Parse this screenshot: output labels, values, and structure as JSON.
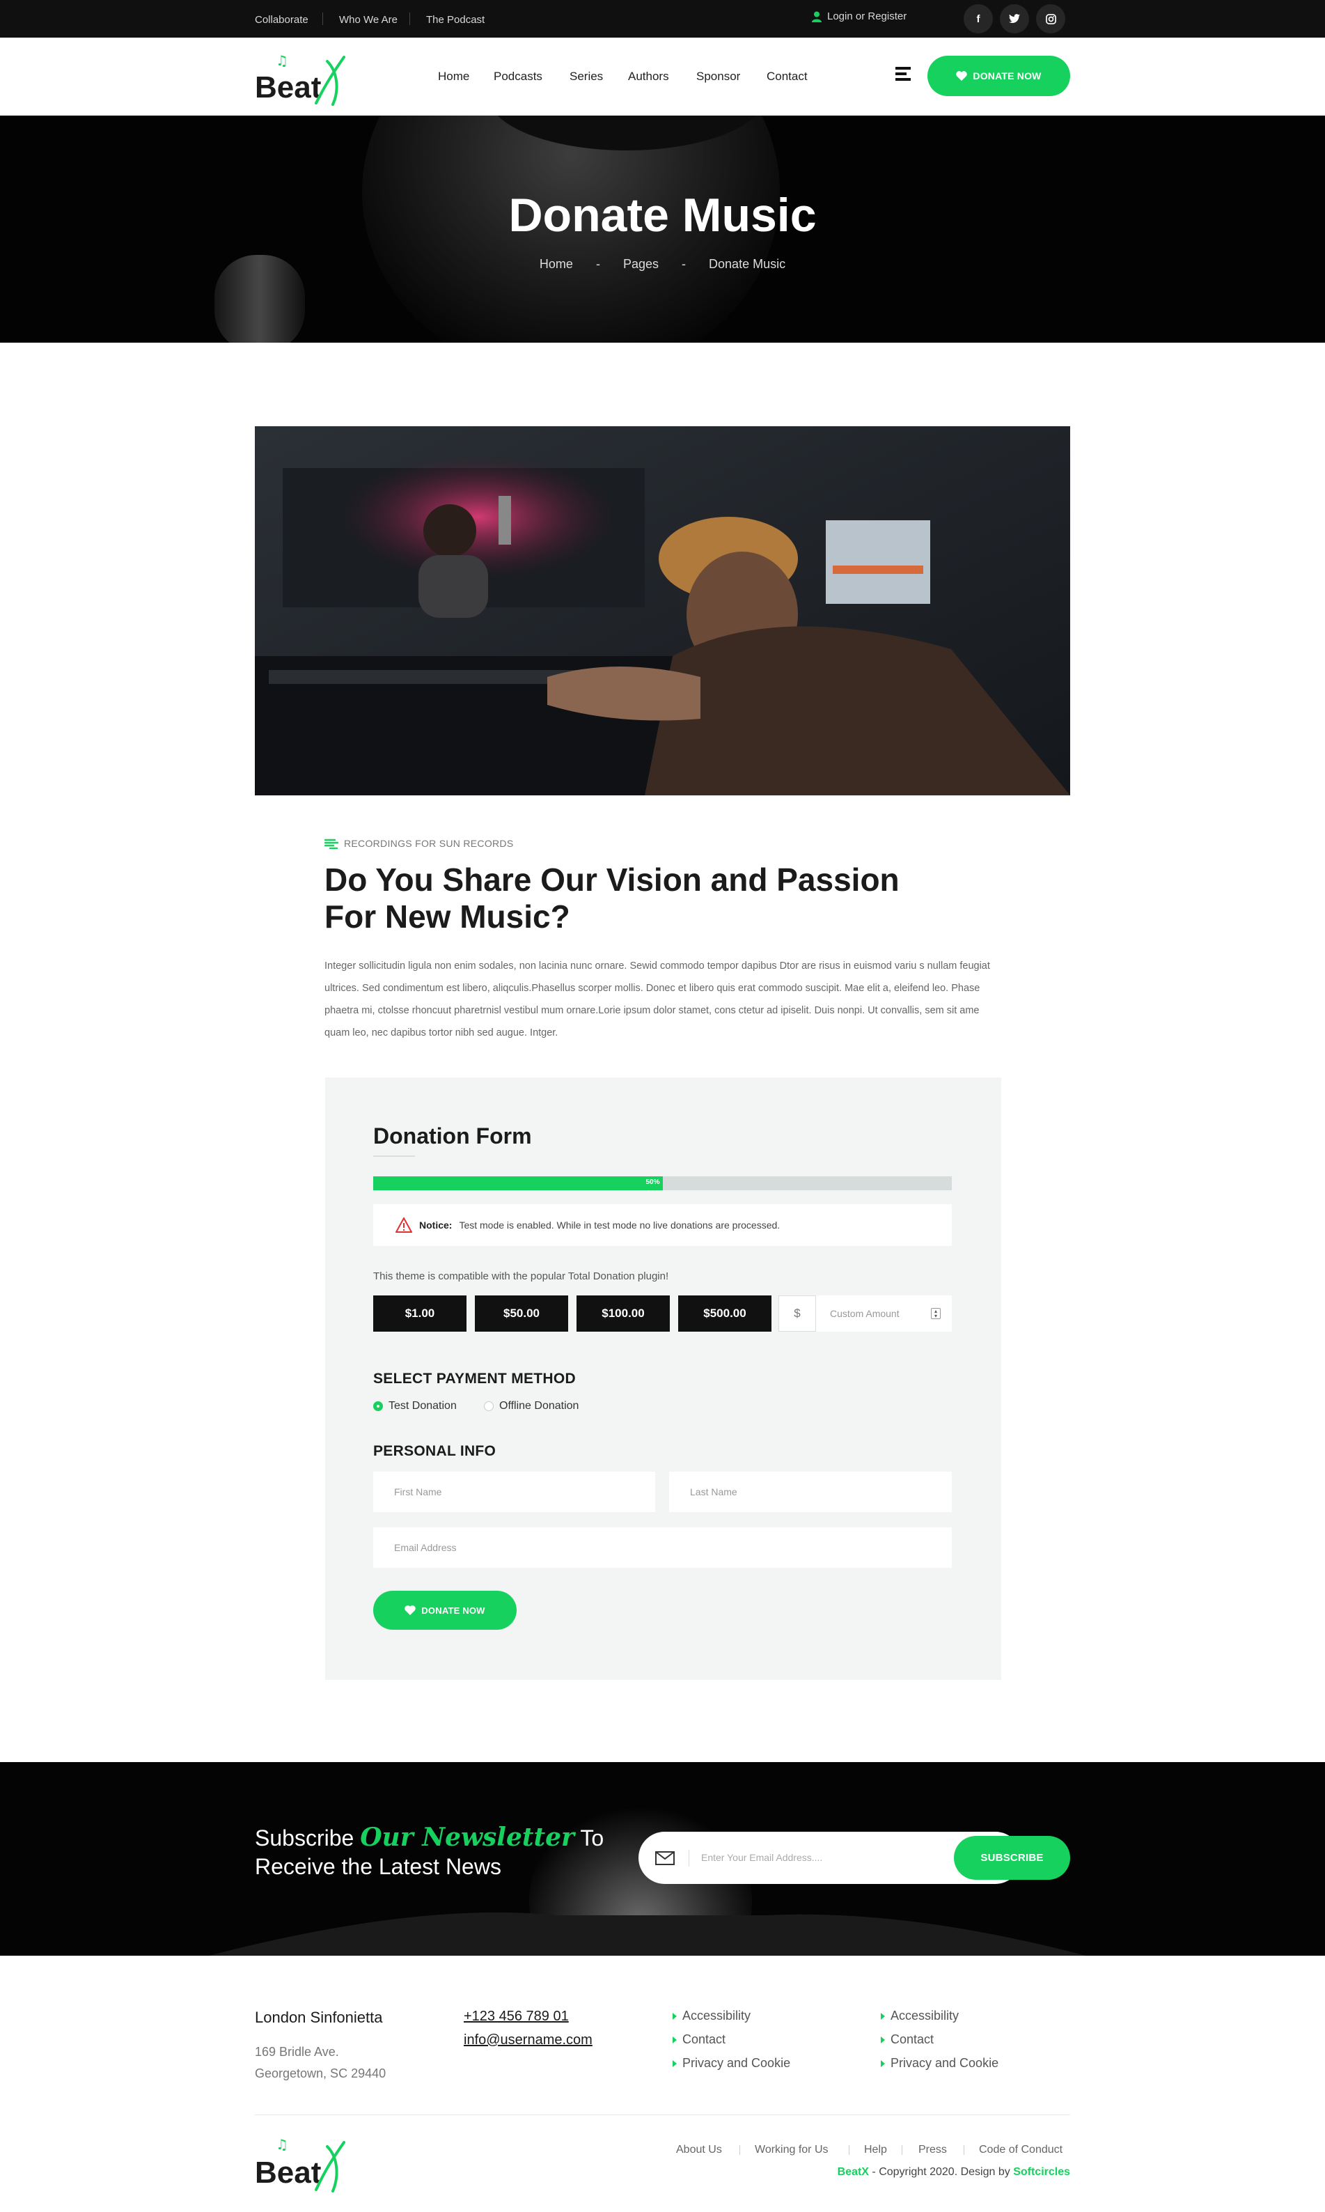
{
  "topbar": {
    "links": [
      "Collaborate",
      "Who We Are",
      "The Podcast"
    ],
    "login": "Login or Register",
    "social": [
      {
        "icon": "facebook-icon",
        "glyph": "f"
      },
      {
        "icon": "twitter-icon",
        "glyph": "t"
      },
      {
        "icon": "instagram-icon",
        "glyph": "◎"
      }
    ]
  },
  "header": {
    "logo_text": "Beat",
    "logo_accent": "X",
    "nav": [
      "Home",
      "Podcasts",
      "Series",
      "Authors",
      "Sponsor",
      "Contact"
    ],
    "donate_label": "DONATE NOW"
  },
  "hero": {
    "title": "Donate Music",
    "breadcrumb": [
      "Home",
      "-",
      "Pages",
      "-",
      "Donate Music"
    ]
  },
  "intro": {
    "eyebrow": "RECORDINGS FOR SUN RECORDS",
    "heading_line1": "Do You Share Our Vision and Passion",
    "heading_line2": "For New Music?",
    "paragraph": "Integer sollicitudin ligula non enim sodales, non lacinia nunc ornare. Sewid commodo tempor dapibus Dtor are risus in euismod variu s nullam feugiat ultrices. Sed condimentum est libero, aliqculis.Phasellus scorper mollis. Donec et libero quis erat commodo suscipit. Mae elit a, eleifend leo. Phase phaetra mi, ctolsse rhoncuut pharetrnisl vestibul mum ornare.Lorie ipsum dolor stamet, cons ctetur ad ipiselit. Duis nonpi. Ut convallis, sem sit ame quam leo, nec dapibus tortor nibh sed augue. Intger."
  },
  "donation_form": {
    "title": "Donation Form",
    "progress_percent": 50,
    "progress_label": "50%",
    "notice_label": "Notice:",
    "notice_text": "Test mode is enabled. While in test mode no live donations are processed.",
    "compat_text": "This theme is compatible with the popular Total Donation plugin!",
    "amounts": [
      "$1.00",
      "$50.00",
      "$100.00",
      "$500.00"
    ],
    "currency_symbol": "$",
    "custom_amount_placeholder": "Custom Amount",
    "payment_heading": "SELECT PAYMENT METHOD",
    "payment_options": [
      {
        "label": "Test Donation",
        "selected": true
      },
      {
        "label": "Offline Donation",
        "selected": false
      }
    ],
    "personal_heading": "PERSONAL INFO",
    "first_name_placeholder": "First Name",
    "last_name_placeholder": "Last Name",
    "email_placeholder": "Email Address",
    "submit_label": "DONATE NOW"
  },
  "newsletter": {
    "heading_pre": "Subscribe",
    "heading_accent": "Our Newsletter",
    "heading_post": "To",
    "heading_line2": "Receive the Latest News",
    "input_placeholder": "Enter Your Email Address....",
    "button_label": "SUBSCRIBE"
  },
  "footer": {
    "org_name": "London Sinfonietta",
    "address_line1": "169 Bridle Ave.",
    "address_line2": "Georgetown, SC 29440",
    "phone": "+123 456 789 01",
    "email": "info@username.com",
    "col1": [
      "Accessibility",
      "Contact",
      "Privacy and Cookie"
    ],
    "col2": [
      "Accessibility",
      "Contact",
      "Privacy and Cookie"
    ],
    "bottom_links": [
      "About Us",
      "Working for Us",
      "Help",
      "Press",
      "Code of Conduct"
    ],
    "copyright_brand": "BeatX",
    "copyright_text": " - Copyright 2020. Design by ",
    "copyright_author": "Softcircles"
  },
  "colors": {
    "accent": "#17d15f",
    "dark": "#101010"
  }
}
